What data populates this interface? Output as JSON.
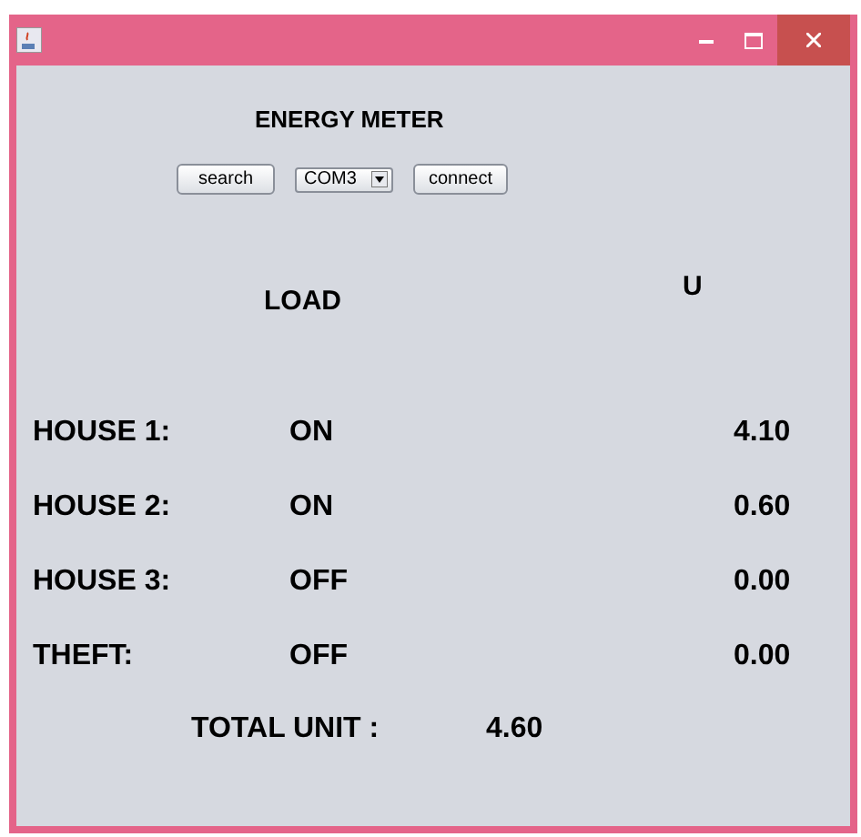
{
  "title": "ENERGY METER",
  "controls": {
    "search_button": "search",
    "port": "COM3",
    "connect_button": "connect"
  },
  "headers": {
    "load": "LOAD",
    "units": "U"
  },
  "rows": [
    {
      "name": "HOUSE 1:",
      "status": "ON",
      "value": "4.10"
    },
    {
      "name": "HOUSE 2:",
      "status": "ON",
      "value": "0.60"
    },
    {
      "name": "HOUSE 3:",
      "status": "OFF",
      "value": "0.00"
    },
    {
      "name": "THEFT:",
      "status": "OFF",
      "value": "0.00"
    }
  ],
  "total": {
    "label": "TOTAL UNIT :",
    "value": "4.60"
  }
}
